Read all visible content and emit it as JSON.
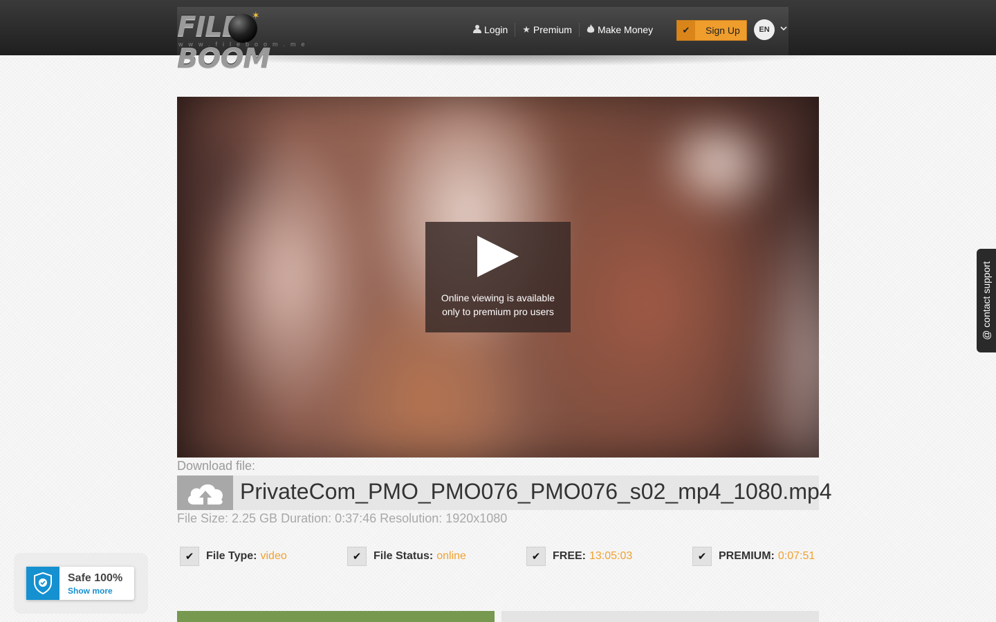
{
  "header": {
    "logo": {
      "brand": "FILEBOOM",
      "url_text": "www.fileboom.me"
    },
    "nav": [
      {
        "label": "Login",
        "icon": "user-icon"
      },
      {
        "label": "Premium",
        "icon": "star-icon"
      },
      {
        "label": "Make Money",
        "icon": "fire-icon"
      }
    ],
    "signup_label": "Sign Up",
    "language": "EN"
  },
  "video": {
    "overlay_text": "Online viewing is available only to premium pro users"
  },
  "download": {
    "label": "Download file:",
    "file_name": "PrivateCom_PMO_PMO076_PMO076_s02_mp4_1080.mp4",
    "meta": "File Size: 2.25 GB Duration: 0:37:46 Resolution: 1920x1080"
  },
  "stats": [
    {
      "label": "File Type:",
      "value": "video"
    },
    {
      "label": "File Status:",
      "value": "online"
    },
    {
      "label": "FREE:",
      "value": "13:05:03"
    },
    {
      "label": "PREMIUM:",
      "value": "0:07:51"
    }
  ],
  "safe_badge": {
    "title": "Safe 100%",
    "link": "Show more"
  },
  "support_tab": {
    "label": "@ contact support"
  },
  "colors": {
    "accent": "#ef9d2c",
    "header": "#2b2b2b",
    "value": "#f0a030",
    "safe": "#1590d1",
    "green": "#76984f"
  }
}
